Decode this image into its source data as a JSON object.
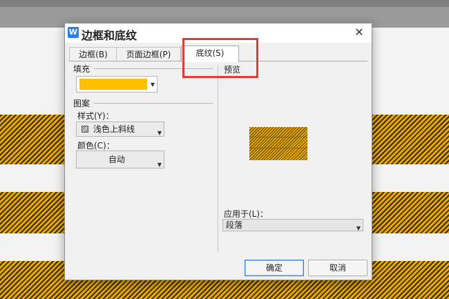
{
  "dialog": {
    "title": "边框和底纹",
    "close_glyph": "✕",
    "app_icon_glyph": "W"
  },
  "tabs": [
    {
      "label": "边框(B)"
    },
    {
      "label": "页面边框(P)"
    },
    {
      "label": "底纹(S)"
    }
  ],
  "shading": {
    "fill_label": "填充",
    "fill_color": "#ffc000",
    "pattern_label": "图案",
    "style_label": "样式(Y)：",
    "style_value": "浅色上斜线",
    "color_label": "颜色(C)：",
    "color_value": "自动",
    "preview_label": "预览",
    "apply_label": "应用于(L)：",
    "apply_value": "段落"
  },
  "buttons": {
    "ok": "确定",
    "cancel": "取消"
  },
  "colors": {
    "highlight": "#e53935",
    "hatch_gold": "#e8a800"
  }
}
